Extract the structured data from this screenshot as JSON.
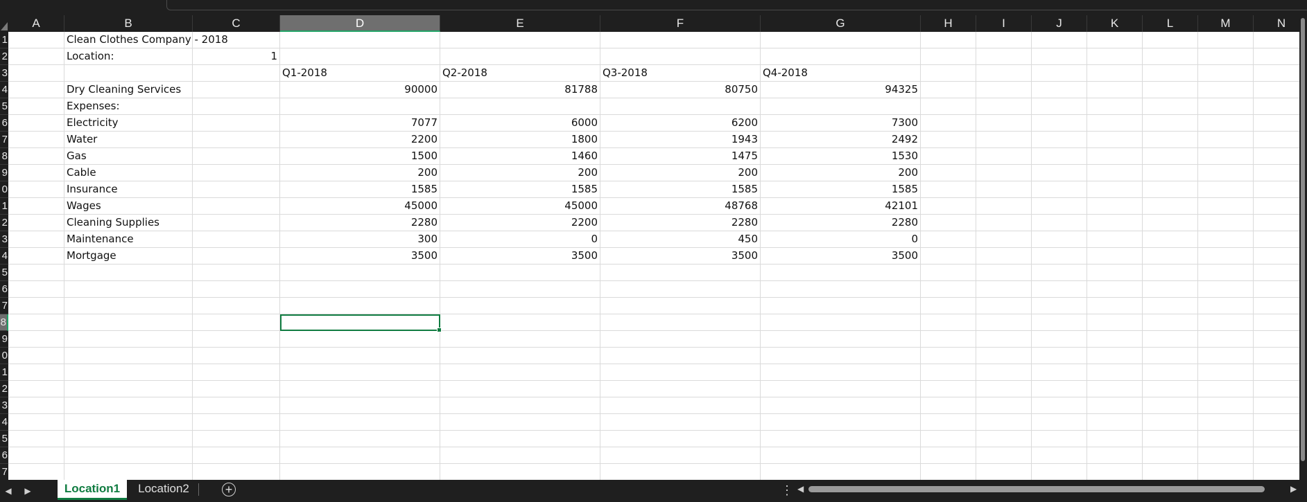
{
  "columns": [
    "A",
    "B",
    "C",
    "D",
    "E",
    "F",
    "G",
    "H",
    "I",
    "J",
    "K",
    "L",
    "M",
    "N"
  ],
  "selected_column": "D",
  "row_labels": [
    "1",
    "2",
    "3",
    "4",
    "5",
    "6",
    "7",
    "8",
    "9",
    "0",
    "1",
    "2",
    "3",
    "4",
    "5",
    "6",
    "7",
    "8",
    "9",
    "0",
    "1",
    "2",
    "3",
    "4",
    "5",
    "6",
    "7"
  ],
  "selected_row_index": 17,
  "active_cell": "D18",
  "cells": {
    "B1": "Clean Clothes Company - 2018",
    "B2": "Location:",
    "C2": "1",
    "D3": "Q1-2018",
    "E3": "Q2-2018",
    "F3": "Q3-2018",
    "G3": "Q4-2018",
    "B4": "Dry Cleaning Services",
    "D4": "90000",
    "E4": "81788",
    "F4": "80750",
    "G4": "94325",
    "B5": "Expenses:",
    "B6": "Electricity",
    "D6": "7077",
    "E6": "6000",
    "F6": "6200",
    "G6": "7300",
    "B7": "Water",
    "D7": "2200",
    "E7": "1800",
    "F7": "1943",
    "G7": "2492",
    "B8": "Gas",
    "D8": "1500",
    "E8": "1460",
    "F8": "1475",
    "G8": "1530",
    "B9": "Cable",
    "D9": "200",
    "E9": "200",
    "F9": "200",
    "G9": "200",
    "B10": "Insurance",
    "D10": "1585",
    "E10": "1585",
    "F10": "1585",
    "G10": "1585",
    "B11": "Wages",
    "D11": "45000",
    "E11": "45000",
    "F11": "48768",
    "G11": "42101",
    "B12": "Cleaning Supplies",
    "D12": "2280",
    "E12": "2200",
    "F12": "2280",
    "G12": "2280",
    "B13": "Maintenance",
    "D13": "300",
    "E13": "0",
    "F13": "450",
    "G13": "0",
    "B14": "Mortgage",
    "D14": "3500",
    "E14": "3500",
    "F14": "3500",
    "G14": "3500"
  },
  "sheet_tabs": {
    "active": "Location1",
    "other": "Location2"
  },
  "icons": {
    "prev_sheet": "chevron-left-icon",
    "next_sheet": "chevron-right-icon",
    "add_sheet": "plus-circle-icon",
    "more_options": "vertical-dots-icon"
  },
  "colors": {
    "accent": "#107c41",
    "header_bg": "#1f1f1f",
    "selected_header_bg": "#6f6f6f"
  }
}
